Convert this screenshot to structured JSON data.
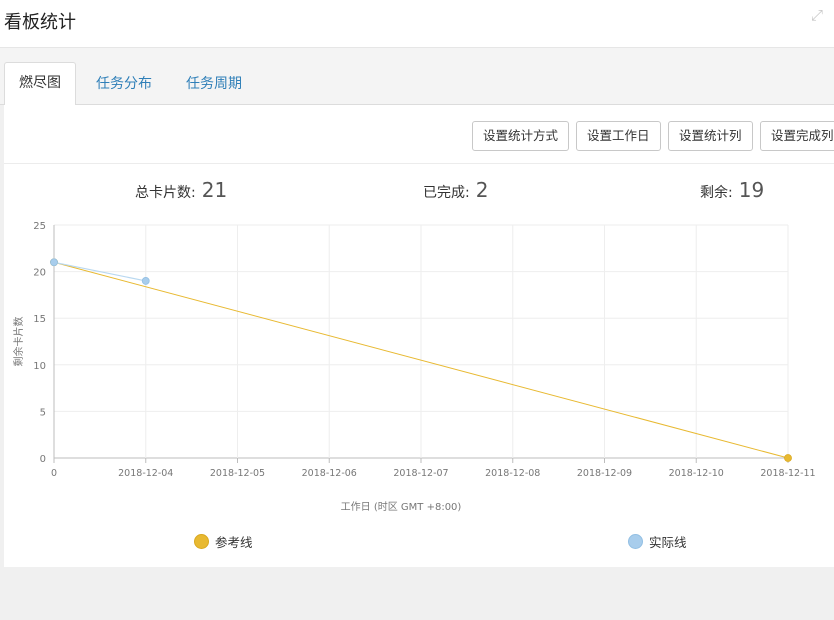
{
  "header": {
    "title": "看板统计",
    "expand_icon": "expand-icon"
  },
  "tabs": [
    {
      "label": "燃尽图",
      "active": true
    },
    {
      "label": "任务分布",
      "active": false
    },
    {
      "label": "任务周期",
      "active": false
    }
  ],
  "toolbar": {
    "buttons": [
      "设置统计方式",
      "设置工作日",
      "设置统计列",
      "设置完成列"
    ]
  },
  "stats": {
    "total_label": "总卡片数:",
    "total_value": "21",
    "done_label": "已完成:",
    "done_value": "2",
    "remaining_label": "剩余:",
    "remaining_value": "19"
  },
  "chart_data": {
    "type": "line",
    "ylabel": "剩余卡片数",
    "xlabel": "工作日 (时区 GMT +8:00)",
    "ylim": [
      0,
      25
    ],
    "yticks": [
      0,
      5,
      10,
      15,
      20,
      25
    ],
    "categories": [
      "0",
      "2018-12-04",
      "2018-12-05",
      "2018-12-06",
      "2018-12-07",
      "2018-12-08",
      "2018-12-09",
      "2018-12-10",
      "2018-12-11"
    ],
    "grid": true,
    "legend_position": "bottom",
    "series": [
      {
        "name": "参考线",
        "color": "#e8b931",
        "values": [
          21,
          null,
          null,
          null,
          null,
          null,
          null,
          null,
          0
        ]
      },
      {
        "name": "实际线",
        "color": "#a8cdec",
        "values": [
          21,
          19,
          null,
          null,
          null,
          null,
          null,
          null,
          null
        ]
      }
    ]
  }
}
